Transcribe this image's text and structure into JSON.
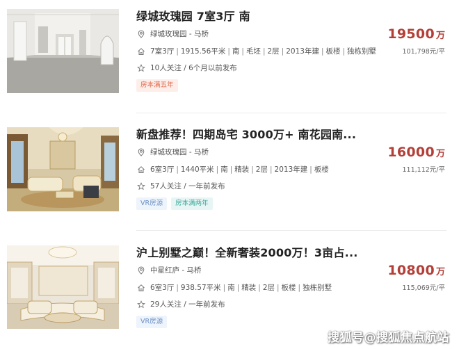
{
  "listings": [
    {
      "title": "绿城玫瑰园 7室3厅 南",
      "location": "绿城玫瑰园 - 马桥",
      "info": [
        "7室3厅",
        "1915.56平米",
        "南",
        "毛坯",
        "2层",
        "2013年建",
        "板楼",
        "独栋别墅"
      ],
      "follow": "10人关注 / 6个月以前发布",
      "tags": [
        {
          "label": "房本满五年",
          "style": "orange"
        }
      ],
      "price": "19500",
      "price_unit": "万",
      "unit_price": "101,798元/平"
    },
    {
      "title": "新盘推荐！四期岛宅 3000万+ 南花园南...",
      "location": "绿城玫瑰园 - 马桥",
      "info": [
        "6室3厅",
        "1440平米",
        "南",
        "精装",
        "2层",
        "2013年建",
        "板楼"
      ],
      "follow": "57人关注 / 一年前发布",
      "tags": [
        {
          "label": "VR房源",
          "style": "blue"
        },
        {
          "label": "房本满两年",
          "style": "teal"
        }
      ],
      "price": "16000",
      "price_unit": "万",
      "unit_price": "111,112元/平"
    },
    {
      "title": "沪上别墅之巅！全新奢装2000万！3亩占...",
      "location": "中星红庐 - 马桥",
      "info": [
        "6室3厅",
        "938.57平米",
        "南",
        "精装",
        "2层",
        "板楼",
        "独栋别墅"
      ],
      "follow": "29人关注 / 一年前发布",
      "tags": [
        {
          "label": "VR房源",
          "style": "blue"
        }
      ],
      "price": "10800",
      "price_unit": "万",
      "unit_price": "115,069元/平"
    }
  ],
  "watermark": "搜狐号@搜狐焦点航站",
  "colors": {
    "price": "#b33f38",
    "tag_orange": "#e1694c",
    "tag_blue": "#6b8fc6",
    "tag_teal": "#3aa79a"
  },
  "icons": {
    "location": "location-pin-icon",
    "info": "house-icon",
    "follow": "star-icon"
  }
}
